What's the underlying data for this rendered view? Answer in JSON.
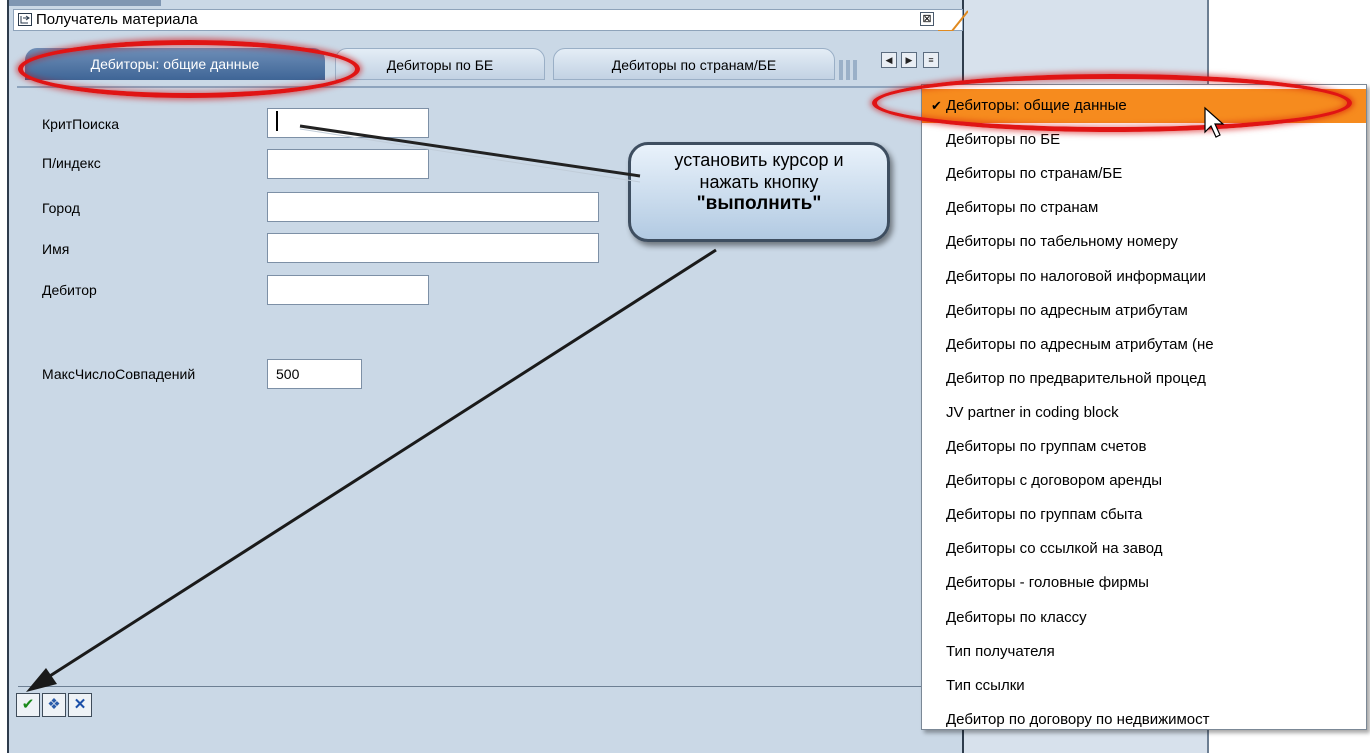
{
  "dialog": {
    "title": "Получатель материала",
    "close_glyph": "⊠"
  },
  "tabs": [
    {
      "label": "Дебиторы: общие данные",
      "active": true
    },
    {
      "label": "Дебиторы по БЕ",
      "active": false
    },
    {
      "label": "Дебиторы по странам/БЕ",
      "active": false
    }
  ],
  "tab_nav": {
    "prev": "◀",
    "next": "▶",
    "list": "≡"
  },
  "form": {
    "fields": [
      {
        "label": "КритПоиска",
        "value": ""
      },
      {
        "label": "П/индекс",
        "value": ""
      },
      {
        "label": "Город",
        "value": ""
      },
      {
        "label": "Имя",
        "value": ""
      },
      {
        "label": "Дебитор",
        "value": ""
      }
    ],
    "max_hits_label": "МаксЧислоСовпадений",
    "max_hits_value": "500"
  },
  "toolbar": {
    "execute_glyph": "✔",
    "multi_glyph": "❖",
    "cancel_glyph": "✕"
  },
  "callout": {
    "line1": "установить курсор и",
    "line2": "нажать кнопку",
    "line3": "\"выполнить\""
  },
  "dropdown": {
    "check_glyph": "✔",
    "items": [
      "Дебиторы: общие данные",
      "Дебиторы по БЕ",
      "Дебиторы по странам/БЕ",
      "Дебиторы по странам",
      "Дебиторы по табельному номеру",
      "Дебиторы по налоговой информации",
      "Дебиторы по адресным атрибутам",
      "Дебиторы по адресным атрибутам (не",
      "Дебитор по предварительной процед",
      "JV partner in coding block",
      "Дебиторы по группам счетов",
      "Дебиторы с договором аренды",
      "Дебиторы по группам сбыта",
      "Дебиторы со ссылкой на завод",
      "Дебиторы - головные фирмы",
      "Дебиторы по классу",
      "Тип получателя",
      "Тип ссылки",
      "Дебитор по договору по недвижимост"
    ],
    "selected_index": 0
  },
  "colors": {
    "dialog_bg": "#cad8e6",
    "highlight_red": "#e01414",
    "selected_orange": "#f68b1e"
  }
}
